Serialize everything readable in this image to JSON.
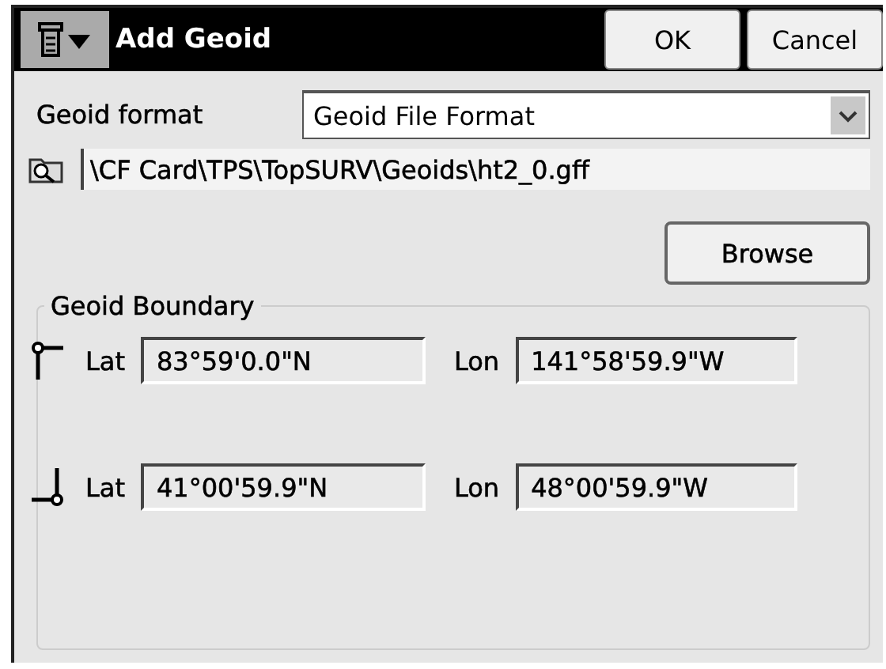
{
  "window": {
    "title": "Add Geoid",
    "buttons": [
      "OK",
      "Cancel"
    ]
  },
  "geoid_format": {
    "label": "Geoid format",
    "value": "Geoid File Format"
  },
  "file_path": {
    "value": "\\CF Card\\TPS\\TopSURV\\Geoids\\ht2_0.gff"
  },
  "browse_button": "Browse",
  "geoid_boundary": {
    "title": "Geoid Boundary",
    "corners": [
      {
        "kind": "top-left",
        "lat_label": "Lat",
        "lat": "83°59'0.0\"N",
        "lon_label": "Lon",
        "lon": "141°58'59.9\"W"
      },
      {
        "kind": "bottom-right",
        "lat_label": "Lat",
        "lat": "41°00'59.9\"N",
        "lon_label": "Lon",
        "lon": "48°00'59.9\"W"
      }
    ]
  }
}
